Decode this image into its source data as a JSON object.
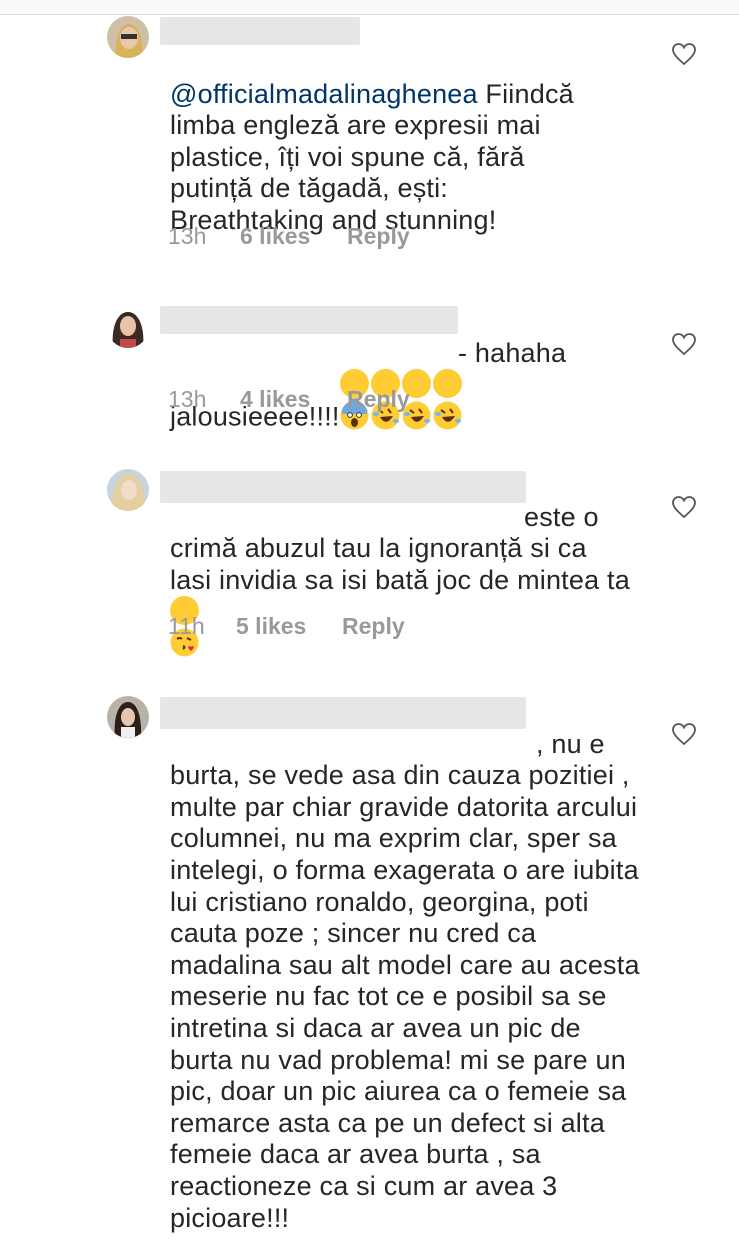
{
  "comments": [
    {
      "mention": "@officialmadalinaghenea",
      "text": " Fiindcă limba engleză are expresii mai plastice, îți voi spune că, fără putință de tăgadă, ești: Breathtaking and stunning!",
      "time": "13h",
      "likes": "6 likes",
      "reply": "Reply"
    },
    {
      "text": "- hahaha jalousieeee!!!!",
      "emoji": [
        "face-screaming-in-fear",
        "rolling-on-floor-laughing",
        "rolling-on-floor-laughing",
        "rolling-on-floor-laughing"
      ],
      "time": "13h",
      "likes": "4 likes",
      "reply": "Reply"
    },
    {
      "text_first": "este o",
      "text": "crimă abuzul tau la ignoranță si ca lasi invidia sa isi bată joc de mintea ta",
      "emoji": [
        "face-blowing-a-kiss"
      ],
      "time": "11h",
      "likes": "5 likes",
      "reply": "Reply"
    },
    {
      "text_first": ", nu e",
      "text": "burta, se  vede asa din cauza pozitiei , multe par chiar gravide datorita arcului columnei, nu ma exprim clar, sper sa intelegi, o forma exagerata o are iubita lui cristiano ronaldo, georgina, poti cauta poze ; sincer nu cred ca madalina sau alt model care au acesta meserie nu fac tot ce e posibil sa se intretina si daca ar avea un pic de burta nu vad problema! mi se pare un pic, doar un pic aiurea ca o femeie sa remarce asta ca pe un defect si alta femeie daca ar avea burta , sa reactioneze ca si cum ar avea 3 picioare!!!"
    }
  ],
  "colors": {
    "text": "#262626",
    "mention": "#003569",
    "meta": "#999999",
    "redaction": "#e6e6e6"
  },
  "icons": {
    "like": "heart-outline-icon"
  }
}
